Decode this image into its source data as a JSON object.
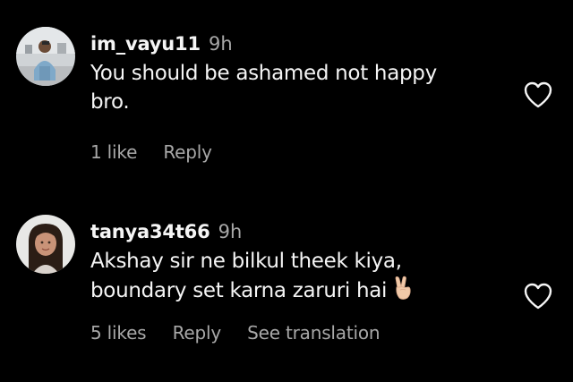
{
  "comments": [
    {
      "username": "im_vayu11",
      "time": "9h",
      "text_lines": [
        "You should be ashamed not happy",
        "bro."
      ],
      "likes": "1 like",
      "reply": "Reply",
      "avatar_icon": "profile-photo-man",
      "like_icon": "heart-outline-icon"
    },
    {
      "username": "tanya34t66",
      "time": "9h",
      "text_lines": [
        "Akshay sir ne bilkul theek kiya,",
        "boundary set karna zaruri hai"
      ],
      "emoji": "victory-hand-emoji",
      "likes": "5 likes",
      "reply": "Reply",
      "see_translation": "See translation",
      "avatar_icon": "profile-photo-woman",
      "like_icon": "heart-outline-icon"
    }
  ],
  "colors": {
    "background": "#000000",
    "primary_text": "#f5f5f5",
    "secondary_text": "#a8a8a8"
  }
}
